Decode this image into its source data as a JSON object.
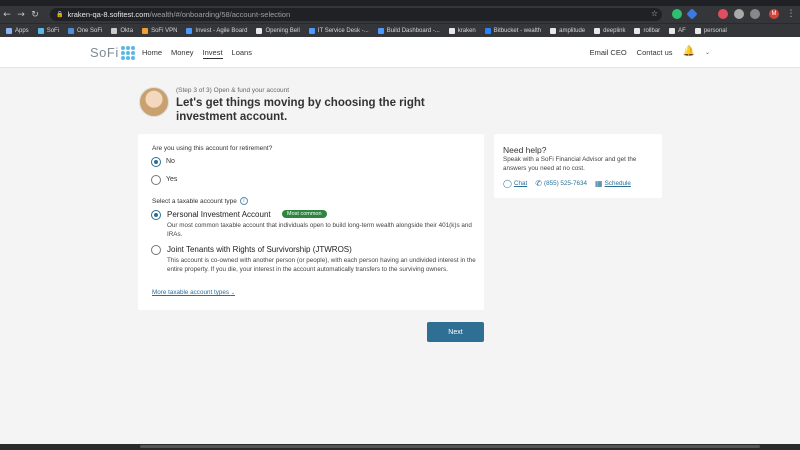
{
  "browser": {
    "url_host": "kraken-qa-8.sofitest.com",
    "url_path": "/wealth/#/onboarding/58/account-selection",
    "bookmarks": [
      {
        "label": "Apps",
        "color": "#8ab4f8"
      },
      {
        "label": "SoFi",
        "color": "#5ab9e6"
      },
      {
        "label": "One SoFi",
        "color": "#4a90d9"
      },
      {
        "label": "Okta",
        "color": "#cccccc"
      },
      {
        "label": "SoFi VPN",
        "color": "#f0a030"
      },
      {
        "label": "Invest - Agile Board",
        "color": "#4c9aff"
      },
      {
        "label": "Opening Bell",
        "color": "#e8e8e8"
      },
      {
        "label": "IT Service Desk -...",
        "color": "#4c9aff"
      },
      {
        "label": "Build Dashboard -...",
        "color": "#4c9aff"
      },
      {
        "label": "kraken",
        "color": "#e8e8e8"
      },
      {
        "label": "Bitbucket - wealth",
        "color": "#2684ff"
      },
      {
        "label": "amplitude",
        "color": "#e8e8e8"
      },
      {
        "label": "deeplink",
        "color": "#e8e8e8"
      },
      {
        "label": "rollbar",
        "color": "#e8e8e8"
      },
      {
        "label": "AF",
        "color": "#e8e8e8"
      },
      {
        "label": "personal",
        "color": "#e8e8e8"
      }
    ]
  },
  "site": {
    "logo": "SoFi",
    "nav": [
      "Home",
      "Money",
      "Invest",
      "Loans"
    ],
    "active_nav": "Invest",
    "right_nav": [
      "Email CEO",
      "Contact us"
    ]
  },
  "page": {
    "step": "(Step 3 of 3) Open & fund your account",
    "title": "Let's get things moving by choosing the right investment account."
  },
  "form": {
    "retirement_question": "Are you using this account for retirement?",
    "retirement_options": [
      "No",
      "Yes"
    ],
    "retirement_selected": "No",
    "account_type_label": "Select a taxable account type",
    "accounts": [
      {
        "title": "Personal Investment Account",
        "badge": "Most common",
        "description": "Our most common taxable account that individuals open to build long-term wealth alongside their 401(k)s and IRAs.",
        "selected": true
      },
      {
        "title": "Joint Tenants with Rights of Survivorship (JTWROS)",
        "description": "This account is co-owned with another person (or people), with each person having an undivided interest in the entire property. If you die, your interest in the account automatically transfers to the surviving owners.",
        "selected": false
      }
    ],
    "more_link": "More taxable account types"
  },
  "help": {
    "title": "Need help?",
    "text": "Speak with a SoFi Financial Advisor and get the answers you need at no cost.",
    "chat": "Chat",
    "phone": "(855) 525-7634",
    "schedule": "Schedule"
  },
  "next_label": "Next",
  "colors": {
    "primary": "#2e6f93",
    "badge_green": "#2e8540",
    "logo_blue": "#5ab9e6"
  }
}
